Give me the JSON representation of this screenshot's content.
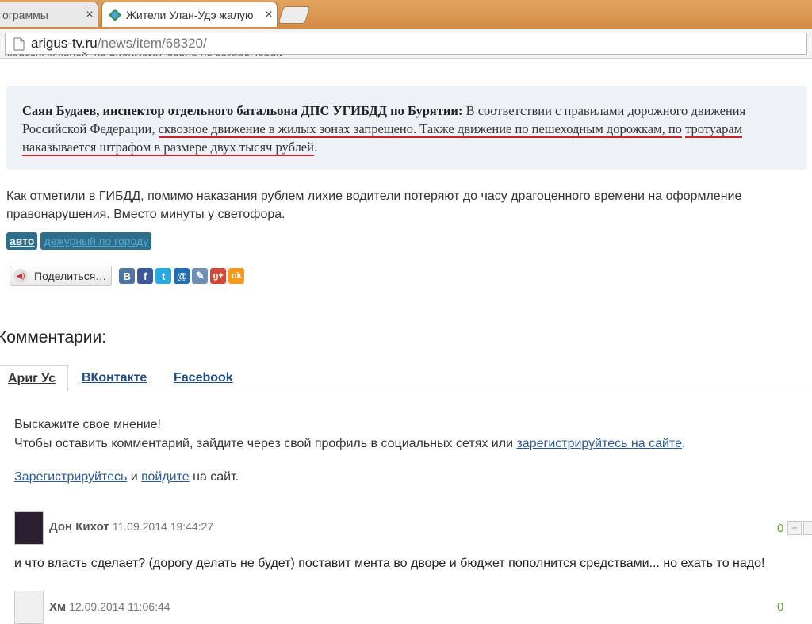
{
  "browser": {
    "tabs": [
      {
        "title": "ограммы",
        "close": "×"
      },
      {
        "title": "Жители Улан-Удэ жалую",
        "close": "×"
      }
    ],
    "address": {
      "host": "arigus-tv.ru",
      "path": "/news/item/68320/"
    }
  },
  "article": {
    "cutoff_text": "железных коней, но видимому, давно не заглядывали.",
    "quote": {
      "speaker": "Саян Будаев, инспектор отдельного батальона ДПС УГИБДД по Бурятии",
      "colon": ":",
      "text_plain": " В соответствии с правилами дорожного движения Российской Федерации, ",
      "text_underlined_1": "сквозное движение в жилых зонах запрещено. Также движение по пешеходным дорожкам, по",
      "text_underlined_2": "тротуарам наказывается штрафом в размере двух тысяч рублей",
      "text_end": "."
    },
    "paragraph": "Как отметили в ГИБДД, помимо наказания рублем лихие водители потеряют до часу драгоценного времени на оформление правонарушения. Вместо минуты у светофора.",
    "tags": [
      "авто",
      "дежурный по городу"
    ],
    "share": {
      "label": "Поделиться…"
    }
  },
  "comments": {
    "title": "Комментарии:",
    "tabs": [
      "Ариг Ус",
      "ВКонтакте",
      "Facebook"
    ],
    "invite_line1": "Выскажите свое мнение!",
    "invite_line2": "Чтобы оставить комментарий, зайдите через свой профиль в социальных сетях или ",
    "invite_link": "зарегистрируйтесь на сайте",
    "invite_end": ".",
    "register_link": "Зарегистрируйтесь",
    "and_text": " и ",
    "login_link": "войдите",
    "site_text": " на сайт.",
    "items": [
      {
        "author": "Дон Кихот",
        "date": "11.09.2014 19:44:27",
        "votes": "0",
        "text": "и что власть сделает? (дорогу делать не будет) поставит мента во дворе и бюджет пополнится средствами... но ехать то надо!"
      },
      {
        "author": "Хм",
        "date": "12.09.2014 11:06:44",
        "votes": "0",
        "text": ""
      }
    ]
  },
  "social_icons": [
    {
      "name": "vkontakte-icon",
      "glyph": "B",
      "color": "#4d75a3"
    },
    {
      "name": "facebook-icon",
      "glyph": "f",
      "color": "#3b5998"
    },
    {
      "name": "twitter-icon",
      "glyph": "t",
      "color": "#29a9e1"
    },
    {
      "name": "mailru-icon",
      "glyph": "@",
      "color": "#1d6fb8"
    },
    {
      "name": "livejournal-icon",
      "glyph": "✎",
      "color": "#6f8fb5"
    },
    {
      "name": "google-plus-icon",
      "glyph": "g+",
      "color": "#d34836"
    },
    {
      "name": "odnoklassniki-icon",
      "glyph": "ok",
      "color": "#f59a1a"
    }
  ]
}
